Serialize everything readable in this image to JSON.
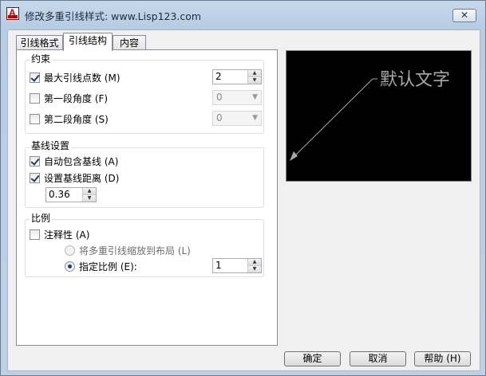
{
  "window": {
    "title": "修改多重引线样式: www.Lisp123.com",
    "close_label": "✕",
    "app_icon_letter": "A"
  },
  "tabs": [
    {
      "label": "引线格式",
      "active": false
    },
    {
      "label": "引线结构",
      "active": true
    },
    {
      "label": "内容",
      "active": false
    }
  ],
  "constraints": {
    "label": "约束",
    "max_points": {
      "label": "最大引线点数 (M)",
      "checked": true,
      "value": "2"
    },
    "first_angle": {
      "label": "第一段角度 (F)",
      "checked": false,
      "value": "0"
    },
    "second_angle": {
      "label": "第二段角度 (S)",
      "checked": false,
      "value": "0"
    }
  },
  "landing": {
    "label": "基线设置",
    "auto_include": {
      "label": "自动包含基线 (A)",
      "checked": true
    },
    "set_distance": {
      "label": "设置基线距离 (D)",
      "checked": true
    },
    "distance_value": "0.36"
  },
  "scale": {
    "label": "比例",
    "annotative": {
      "label": "注释性 (A)",
      "checked": false
    },
    "scale_to_layout": {
      "label": "将多重引线缩放到布局 (L)",
      "selected": false
    },
    "specify_scale": {
      "label": "指定比例 (E):",
      "selected": true
    },
    "scale_value": "1"
  },
  "preview": {
    "text": "默认文字",
    "background": "#000000",
    "text_color": "#a8a8a8"
  },
  "buttons": {
    "ok": "确定",
    "cancel": "取消",
    "help": "帮助 (H)"
  },
  "colors": {
    "title_bar": "#bcd0e6",
    "dialog_bg": "#f0f0f0",
    "check_mark": "#1f3a70"
  }
}
